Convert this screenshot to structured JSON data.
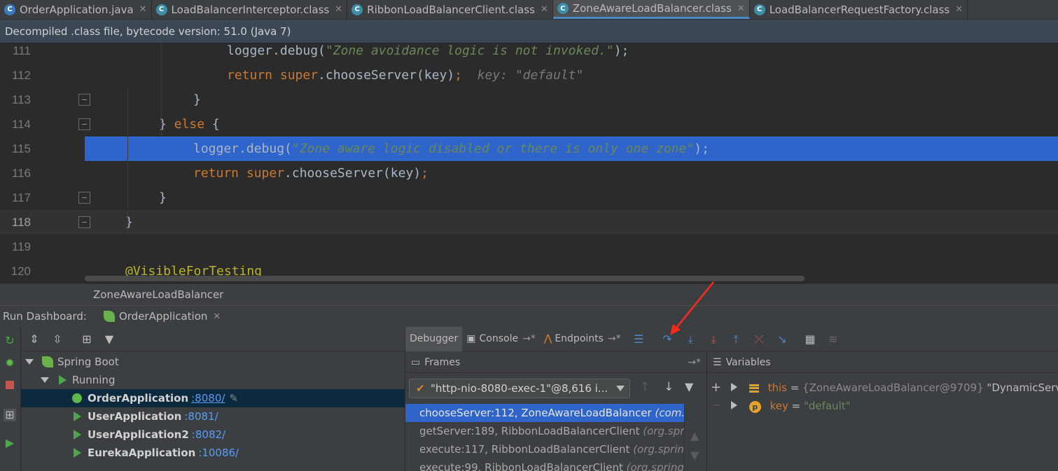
{
  "tabs": [
    {
      "label": "OrderApplication.java",
      "icon": "java-class-icon",
      "active": false
    },
    {
      "label": "LoadBalancerInterceptor.class",
      "icon": "class-file-icon",
      "active": false
    },
    {
      "label": "RibbonLoadBalancerClient.class",
      "icon": "class-file-icon",
      "active": false
    },
    {
      "label": "ZoneAwareLoadBalancer.class",
      "icon": "class-file-icon",
      "active": true
    },
    {
      "label": "LoadBalancerRequestFactory.class",
      "icon": "class-file-icon",
      "active": false
    }
  ],
  "info_bar": "Decompiled .class file, bytecode version: 51.0 (Java 7)",
  "editor": {
    "lines": [
      {
        "no": "111",
        "tokens": [
          [
            "plain",
            "logger.debug("
          ],
          [
            "str",
            "\"Zone avoidance logic is not invoked.\""
          ],
          [
            "plain",
            ");"
          ]
        ]
      },
      {
        "no": "112",
        "tokens": [
          [
            "kw",
            "return super"
          ],
          [
            "plain",
            ".chooseServer(key)"
          ],
          [
            "kw",
            ";"
          ],
          [
            "hint",
            "  key: \"default\""
          ]
        ]
      },
      {
        "no": "113",
        "tokens": [
          [
            "plain",
            "}"
          ]
        ]
      },
      {
        "no": "114",
        "tokens": [
          [
            "plain",
            "} "
          ],
          [
            "kw",
            "else"
          ],
          [
            "plain",
            " {"
          ]
        ]
      },
      {
        "no": "115",
        "tokens": [
          [
            "plain",
            "logger.debug("
          ],
          [
            "str",
            "\"Zone aware logic disabled or there is only one zone\""
          ],
          [
            "plain",
            ");"
          ]
        ]
      },
      {
        "no": "116",
        "tokens": [
          [
            "kw",
            "return super"
          ],
          [
            "plain",
            ".chooseServer(key)"
          ],
          [
            "kw",
            ";"
          ]
        ]
      },
      {
        "no": "117",
        "tokens": [
          [
            "plain",
            "}"
          ]
        ]
      },
      {
        "no": "118",
        "tokens": [
          [
            "plain",
            "}"
          ]
        ]
      },
      {
        "no": "119",
        "tokens": []
      },
      {
        "no": "120",
        "tokens": [
          [
            "ann",
            "@VisibleForTesting"
          ]
        ]
      }
    ]
  },
  "breadcrumb": "ZoneAwareLoadBalancer",
  "run_dashboard": {
    "title": "Run Dashboard:",
    "tab_label": "OrderApplication",
    "tree": {
      "root": "Spring Boot",
      "group": "Running",
      "apps": [
        {
          "name": "OrderApplication",
          "port": ":8080/",
          "debug": true
        },
        {
          "name": "UserApplication",
          "port": ":8081/",
          "debug": false
        },
        {
          "name": "UserApplication2",
          "port": ":8082/",
          "debug": false
        },
        {
          "name": "EurekaApplication",
          "port": ":10086/",
          "debug": false
        }
      ]
    }
  },
  "debugger": {
    "tabs": [
      "Debugger",
      "Console",
      "Endpoints"
    ],
    "frames_title": "Frames",
    "variables_title": "Variables",
    "thread": "\"http-nio-8080-exec-1\"@8,616 i...",
    "frames": [
      {
        "method": "chooseServer:112, ZoneAwareLoadBalancer",
        "pkg": "(com.netflix"
      },
      {
        "method": "getServer:189, RibbonLoadBalancerClient",
        "pkg": "(org.springfra"
      },
      {
        "method": "execute:117, RibbonLoadBalancerClient",
        "pkg": "(org.springfram"
      },
      {
        "method": "execute:99, RibbonLoadBalancerClient",
        "pkg": "(org.springframe"
      }
    ],
    "variables": [
      {
        "name": "this",
        "eq": " = ",
        "value": "{ZoneAwareLoadBalancer@9709}",
        "extra": " \"DynamicServerLis"
      },
      {
        "name": "key",
        "eq": " = ",
        "value": "\"default\"",
        "badge": "p"
      }
    ]
  },
  "colors": {
    "selection": "#2f65ca",
    "keyword": "#cc7832",
    "string": "#6a8759",
    "accent": "#4a88c7"
  }
}
